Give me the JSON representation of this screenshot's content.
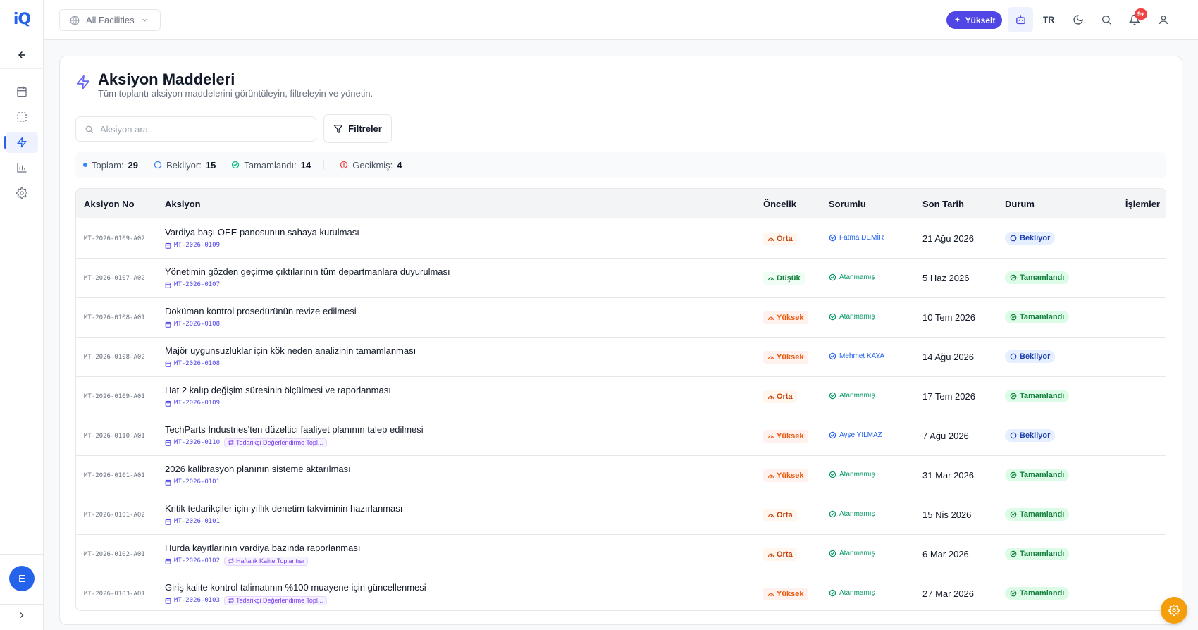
{
  "app": {
    "logo_text": "iQ"
  },
  "sidebar": {
    "items": [
      {
        "icon": "calendar-icon"
      },
      {
        "icon": "dashed-square-icon"
      },
      {
        "icon": "lightning-icon",
        "active": true
      },
      {
        "icon": "bar-chart-icon"
      },
      {
        "icon": "gear-icon"
      }
    ],
    "avatar_initial": "E"
  },
  "topbar": {
    "facility_label": "All Facilities",
    "upgrade_label": "Yükselt",
    "language": "TR",
    "notification_count": "9+"
  },
  "page": {
    "title": "Aksiyon Maddeleri",
    "subtitle": "Tüm toplantı aksiyon maddelerini görüntüleyin, filtreleyin ve yönetin.",
    "search_placeholder": "Aksiyon ara...",
    "filter_label": "Filtreler"
  },
  "stats": {
    "total_label": "Toplam:",
    "total": "29",
    "pending_label": "Bekliyor:",
    "pending": "15",
    "done_label": "Tamamlandı:",
    "done": "14",
    "overdue_label": "Gecikmiş:",
    "overdue": "4"
  },
  "table": {
    "columns": {
      "id": "Aksiyon No",
      "action": "Aksiyon",
      "priority": "Öncelik",
      "owner": "Sorumlu",
      "due": "Son Tarih",
      "status": "Durum",
      "ops": "İşlemler"
    },
    "rows": [
      {
        "id": "MT-2026-0109-A02",
        "title": "Vardiya başı OEE panosunun sahaya kurulması",
        "meeting": "MT-2026-0109",
        "series": "",
        "priority": "Orta",
        "priority_class": "orta",
        "owner": "Fatma DEMİR",
        "owner_class": "assigned",
        "due": "21 Ağu 2026",
        "status": "Bekliyor",
        "status_class": "pending"
      },
      {
        "id": "MT-2026-0107-A02",
        "title": "Yönetimin gözden geçirme çıktılarının tüm departmanlara duyurulması",
        "meeting": "MT-2026-0107",
        "series": "",
        "priority": "Düşük",
        "priority_class": "dusuk",
        "owner": "Atanmamış",
        "owner_class": "unassigned",
        "due": "5 Haz 2026",
        "status": "Tamamlandı",
        "status_class": "done"
      },
      {
        "id": "MT-2026-0108-A01",
        "title": "Doküman kontrol prosedürünün revize edilmesi",
        "meeting": "MT-2026-0108",
        "series": "",
        "priority": "Yüksek",
        "priority_class": "yuksek",
        "owner": "Atanmamış",
        "owner_class": "unassigned",
        "due": "10 Tem 2026",
        "status": "Tamamlandı",
        "status_class": "done"
      },
      {
        "id": "MT-2026-0108-A02",
        "title": "Majör uygunsuzluklar için kök neden analizinin tamamlanması",
        "meeting": "MT-2026-0108",
        "series": "",
        "priority": "Yüksek",
        "priority_class": "yuksek",
        "owner": "Mehmet KAYA",
        "owner_class": "assigned",
        "due": "14 Ağu 2026",
        "status": "Bekliyor",
        "status_class": "pending"
      },
      {
        "id": "MT-2026-0109-A01",
        "title": "Hat 2 kalıp değişim süresinin ölçülmesi ve raporlanması",
        "meeting": "MT-2026-0109",
        "series": "",
        "priority": "Orta",
        "priority_class": "orta",
        "owner": "Atanmamış",
        "owner_class": "unassigned",
        "due": "17 Tem 2026",
        "status": "Tamamlandı",
        "status_class": "done"
      },
      {
        "id": "MT-2026-0110-A01",
        "title": "TechParts Industries'ten düzeltici faaliyet planının talep edilmesi",
        "meeting": "MT-2026-0110",
        "series": "Tedarikçi Değerlendirme Topl...",
        "priority": "Yüksek",
        "priority_class": "yuksek",
        "owner": "Ayşe YILMAZ",
        "owner_class": "assigned",
        "due": "7 Ağu 2026",
        "status": "Bekliyor",
        "status_class": "pending"
      },
      {
        "id": "MT-2026-0101-A01",
        "title": "2026 kalibrasyon planının sisteme aktarılması",
        "meeting": "MT-2026-0101",
        "series": "",
        "priority": "Yüksek",
        "priority_class": "yuksek",
        "owner": "Atanmamış",
        "owner_class": "unassigned",
        "due": "31 Mar 2026",
        "status": "Tamamlandı",
        "status_class": "done"
      },
      {
        "id": "MT-2026-0101-A02",
        "title": "Kritik tedarikçiler için yıllık denetim takviminin hazırlanması",
        "meeting": "MT-2026-0101",
        "series": "",
        "priority": "Orta",
        "priority_class": "orta",
        "owner": "Atanmamış",
        "owner_class": "unassigned",
        "due": "15 Nis 2026",
        "status": "Tamamlandı",
        "status_class": "done"
      },
      {
        "id": "MT-2026-0102-A01",
        "title": "Hurda kayıtlarının vardiya bazında raporlanması",
        "meeting": "MT-2026-0102",
        "series": "Haftalık Kalite Toplantısı",
        "priority": "Orta",
        "priority_class": "orta",
        "owner": "Atanmamış",
        "owner_class": "unassigned",
        "due": "6 Mar 2026",
        "status": "Tamamlandı",
        "status_class": "done"
      },
      {
        "id": "MT-2026-0103-A01",
        "title": "Giriş kalite kontrol talimatının %100 muayene için güncellenmesi",
        "meeting": "MT-2026-0103",
        "series": "Tedarikçi Değerlendirme Topl...",
        "priority": "Yüksek",
        "priority_class": "yuksek",
        "owner": "Atanmamış",
        "owner_class": "unassigned",
        "due": "27 Mar 2026",
        "status": "Tamamlandı",
        "status_class": "done"
      }
    ]
  }
}
